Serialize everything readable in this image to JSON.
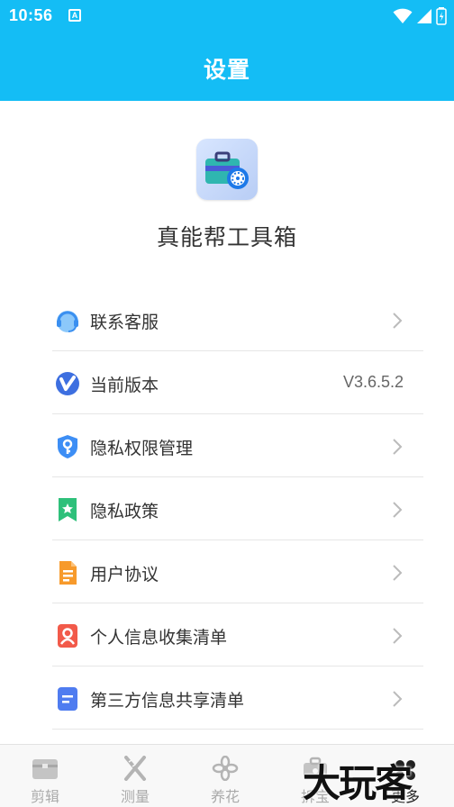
{
  "status_bar": {
    "time": "10:56",
    "notif_letter": "A"
  },
  "header": {
    "title": "设置"
  },
  "app": {
    "name": "真能帮工具箱"
  },
  "menu": {
    "items": [
      {
        "label": "联系客服",
        "icon": "headset-icon",
        "color": "#4aa3f5"
      },
      {
        "label": "当前版本",
        "icon": "version-v-icon",
        "color": "#3d7cf0",
        "value": "V3.6.5.2"
      },
      {
        "label": "隐私权限管理",
        "icon": "shield-key-icon",
        "color": "#3d8ef5"
      },
      {
        "label": "隐私政策",
        "icon": "bookmark-star-icon",
        "color": "#2ec07a"
      },
      {
        "label": "用户协议",
        "icon": "document-icon",
        "color": "#f79a2b"
      },
      {
        "label": "个人信息收集清单",
        "icon": "person-card-icon",
        "color": "#f25a4a"
      },
      {
        "label": "第三方信息共享清单",
        "icon": "list-doc-icon",
        "color": "#4f7cf0"
      }
    ]
  },
  "tabbar": {
    "tabs": [
      {
        "label": "剪辑",
        "icon": "clip-box-icon"
      },
      {
        "label": "测量",
        "icon": "ruler-cross-icon"
      },
      {
        "label": "养花",
        "icon": "flower-icon"
      },
      {
        "label": "拆宝",
        "icon": "gift-box-icon"
      },
      {
        "label": "更多",
        "icon": "more-icon",
        "active": true
      }
    ]
  },
  "watermark": {
    "text": "大玩客"
  }
}
